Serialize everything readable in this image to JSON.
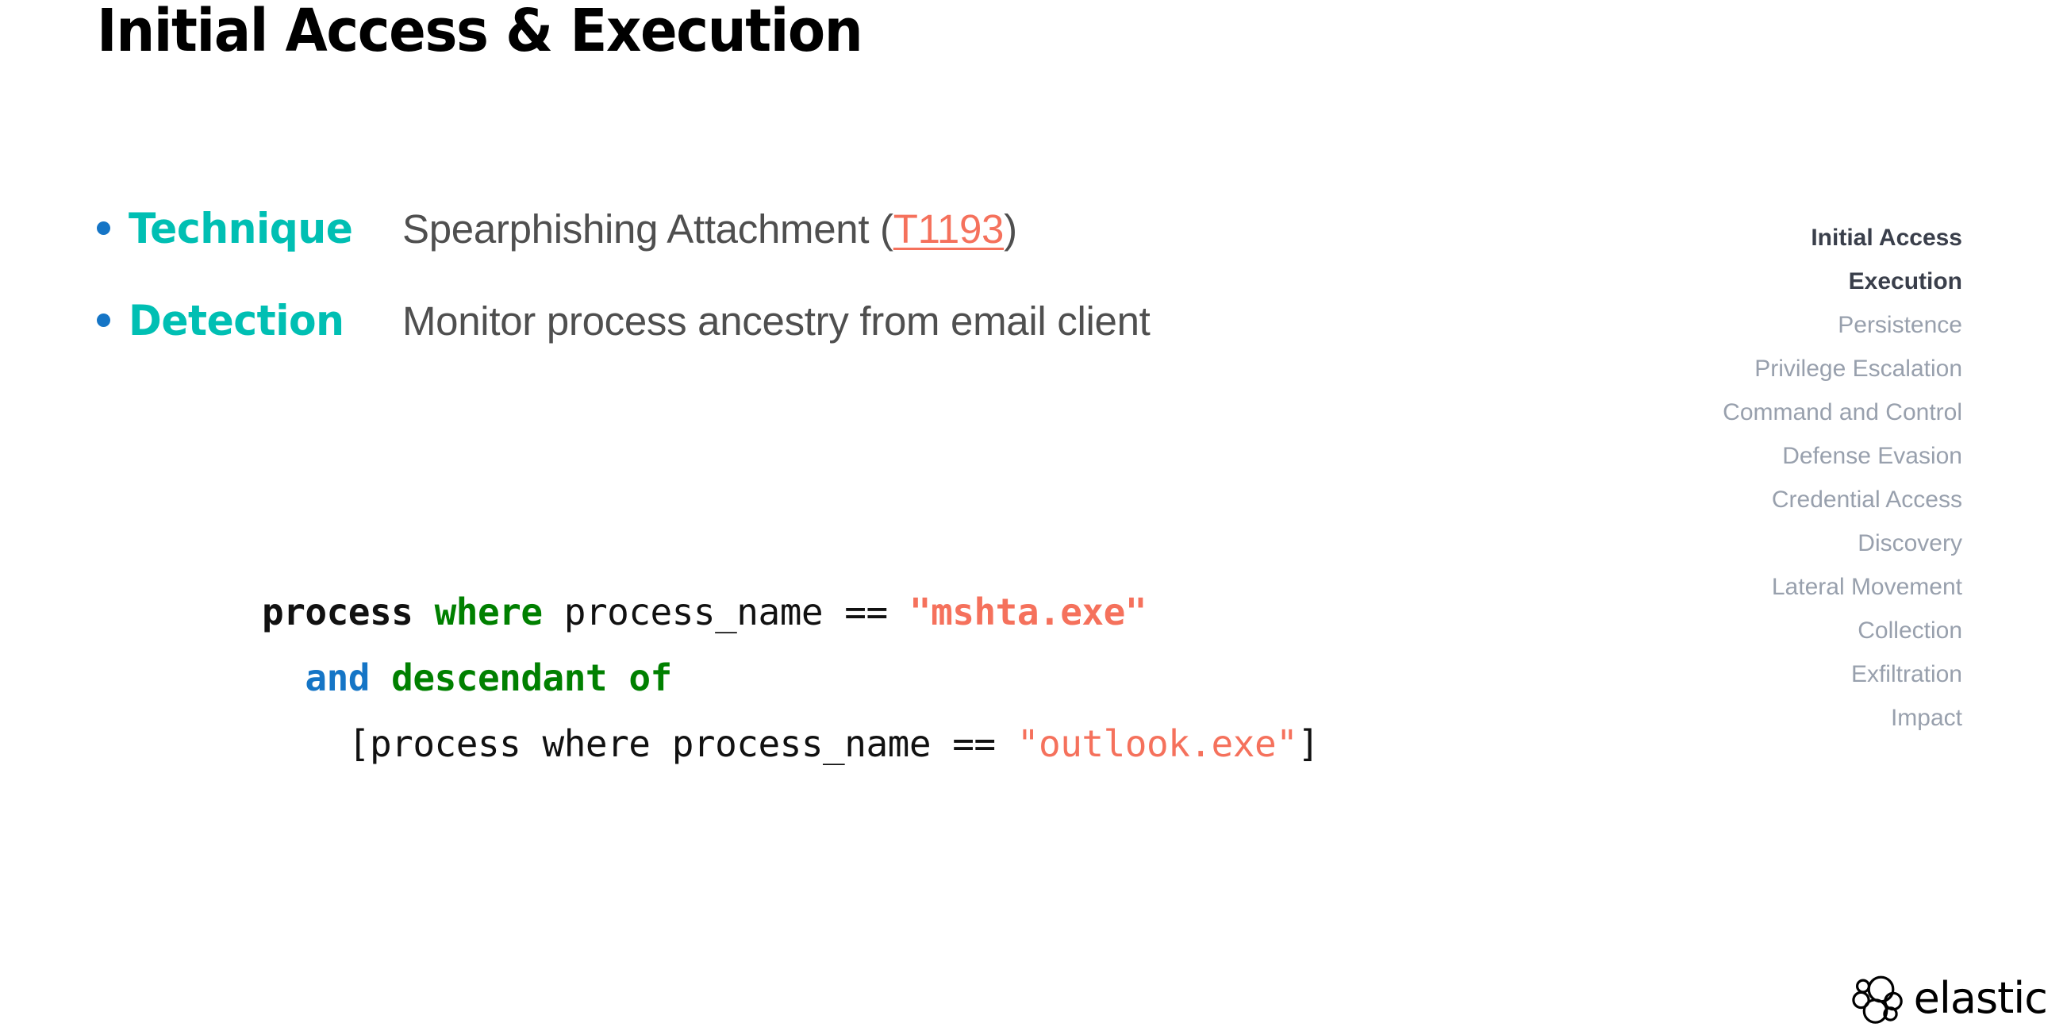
{
  "slide": {
    "title": "Initial Access & Execution"
  },
  "bullets": [
    {
      "label": "Technique",
      "text_before": "Spearphishing Attachment (",
      "link": "T1193",
      "text_after": ")"
    },
    {
      "label": "Detection",
      "text_before": "Monitor process ancestry from email client",
      "link": "",
      "text_after": ""
    }
  ],
  "code": {
    "line1": {
      "keyword": "process",
      "where": "where",
      "field": " process_name == ",
      "value": "\"mshta.exe\""
    },
    "line2": {
      "indent": "  ",
      "and": "and",
      "operator": " descendant of"
    },
    "line3": {
      "indent": "    ",
      "text": "[process where process_name == ",
      "value": "\"outlook.exe\"",
      "close": "]"
    }
  },
  "tactics": [
    {
      "label": "Initial Access",
      "active": true
    },
    {
      "label": "Execution",
      "active": true
    },
    {
      "label": "Persistence",
      "active": false
    },
    {
      "label": "Privilege Escalation",
      "active": false
    },
    {
      "label": "Command and Control",
      "active": false
    },
    {
      "label": "Defense Evasion",
      "active": false
    },
    {
      "label": "Credential Access",
      "active": false
    },
    {
      "label": "Discovery",
      "active": false
    },
    {
      "label": "Lateral Movement",
      "active": false
    },
    {
      "label": "Collection",
      "active": false
    },
    {
      "label": "Exfiltration",
      "active": false
    },
    {
      "label": "Impact",
      "active": false
    }
  ],
  "branding": {
    "wordmark": "elastic",
    "logo_icon": "elastic-cluster-icon"
  },
  "colors": {
    "accent_teal": "#00BFB3",
    "link_orange": "#F5715C",
    "bullet_blue": "#1575C6",
    "code_green": "#008000",
    "body_gray": "#4F4F4F",
    "tactic_inactive": "#98A0AD",
    "tactic_active": "#3A3F4B"
  }
}
